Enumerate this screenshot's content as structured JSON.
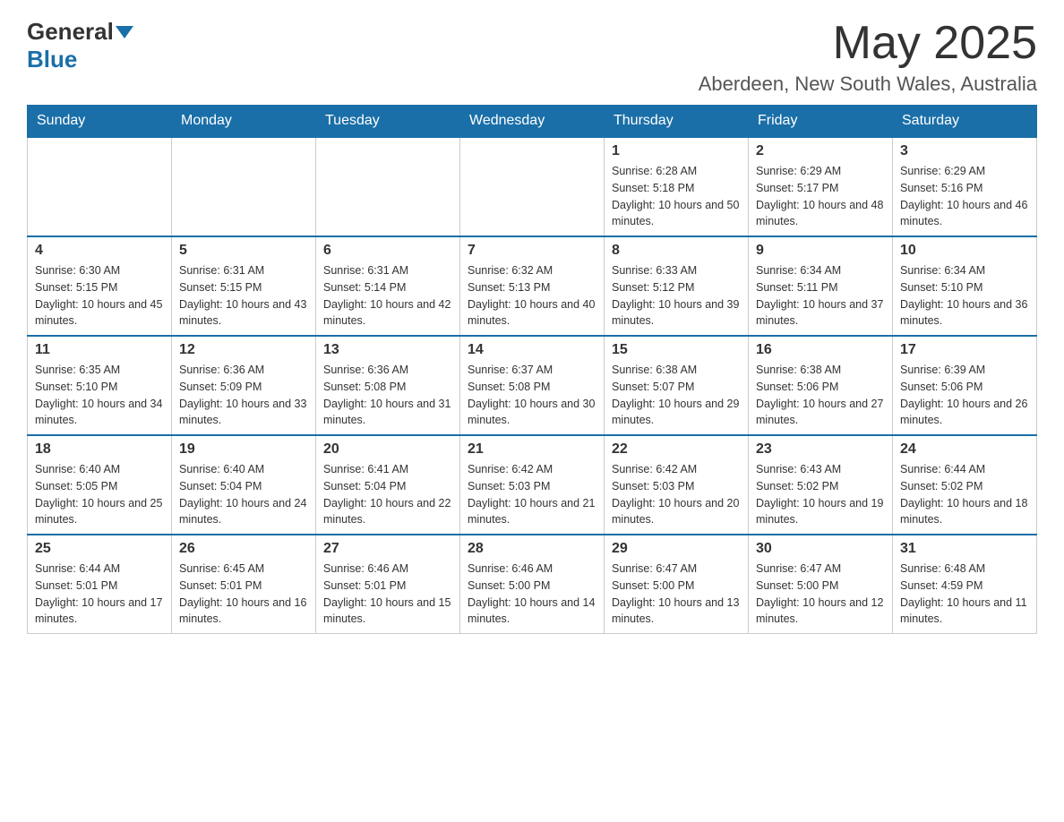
{
  "header": {
    "logo_general": "General",
    "logo_blue": "Blue",
    "month_title": "May 2025",
    "location": "Aberdeen, New South Wales, Australia"
  },
  "calendar": {
    "days_of_week": [
      "Sunday",
      "Monday",
      "Tuesday",
      "Wednesday",
      "Thursday",
      "Friday",
      "Saturday"
    ],
    "weeks": [
      [
        {
          "day": "",
          "info": ""
        },
        {
          "day": "",
          "info": ""
        },
        {
          "day": "",
          "info": ""
        },
        {
          "day": "",
          "info": ""
        },
        {
          "day": "1",
          "info": "Sunrise: 6:28 AM\nSunset: 5:18 PM\nDaylight: 10 hours and 50 minutes."
        },
        {
          "day": "2",
          "info": "Sunrise: 6:29 AM\nSunset: 5:17 PM\nDaylight: 10 hours and 48 minutes."
        },
        {
          "day": "3",
          "info": "Sunrise: 6:29 AM\nSunset: 5:16 PM\nDaylight: 10 hours and 46 minutes."
        }
      ],
      [
        {
          "day": "4",
          "info": "Sunrise: 6:30 AM\nSunset: 5:15 PM\nDaylight: 10 hours and 45 minutes."
        },
        {
          "day": "5",
          "info": "Sunrise: 6:31 AM\nSunset: 5:15 PM\nDaylight: 10 hours and 43 minutes."
        },
        {
          "day": "6",
          "info": "Sunrise: 6:31 AM\nSunset: 5:14 PM\nDaylight: 10 hours and 42 minutes."
        },
        {
          "day": "7",
          "info": "Sunrise: 6:32 AM\nSunset: 5:13 PM\nDaylight: 10 hours and 40 minutes."
        },
        {
          "day": "8",
          "info": "Sunrise: 6:33 AM\nSunset: 5:12 PM\nDaylight: 10 hours and 39 minutes."
        },
        {
          "day": "9",
          "info": "Sunrise: 6:34 AM\nSunset: 5:11 PM\nDaylight: 10 hours and 37 minutes."
        },
        {
          "day": "10",
          "info": "Sunrise: 6:34 AM\nSunset: 5:10 PM\nDaylight: 10 hours and 36 minutes."
        }
      ],
      [
        {
          "day": "11",
          "info": "Sunrise: 6:35 AM\nSunset: 5:10 PM\nDaylight: 10 hours and 34 minutes."
        },
        {
          "day": "12",
          "info": "Sunrise: 6:36 AM\nSunset: 5:09 PM\nDaylight: 10 hours and 33 minutes."
        },
        {
          "day": "13",
          "info": "Sunrise: 6:36 AM\nSunset: 5:08 PM\nDaylight: 10 hours and 31 minutes."
        },
        {
          "day": "14",
          "info": "Sunrise: 6:37 AM\nSunset: 5:08 PM\nDaylight: 10 hours and 30 minutes."
        },
        {
          "day": "15",
          "info": "Sunrise: 6:38 AM\nSunset: 5:07 PM\nDaylight: 10 hours and 29 minutes."
        },
        {
          "day": "16",
          "info": "Sunrise: 6:38 AM\nSunset: 5:06 PM\nDaylight: 10 hours and 27 minutes."
        },
        {
          "day": "17",
          "info": "Sunrise: 6:39 AM\nSunset: 5:06 PM\nDaylight: 10 hours and 26 minutes."
        }
      ],
      [
        {
          "day": "18",
          "info": "Sunrise: 6:40 AM\nSunset: 5:05 PM\nDaylight: 10 hours and 25 minutes."
        },
        {
          "day": "19",
          "info": "Sunrise: 6:40 AM\nSunset: 5:04 PM\nDaylight: 10 hours and 24 minutes."
        },
        {
          "day": "20",
          "info": "Sunrise: 6:41 AM\nSunset: 5:04 PM\nDaylight: 10 hours and 22 minutes."
        },
        {
          "day": "21",
          "info": "Sunrise: 6:42 AM\nSunset: 5:03 PM\nDaylight: 10 hours and 21 minutes."
        },
        {
          "day": "22",
          "info": "Sunrise: 6:42 AM\nSunset: 5:03 PM\nDaylight: 10 hours and 20 minutes."
        },
        {
          "day": "23",
          "info": "Sunrise: 6:43 AM\nSunset: 5:02 PM\nDaylight: 10 hours and 19 minutes."
        },
        {
          "day": "24",
          "info": "Sunrise: 6:44 AM\nSunset: 5:02 PM\nDaylight: 10 hours and 18 minutes."
        }
      ],
      [
        {
          "day": "25",
          "info": "Sunrise: 6:44 AM\nSunset: 5:01 PM\nDaylight: 10 hours and 17 minutes."
        },
        {
          "day": "26",
          "info": "Sunrise: 6:45 AM\nSunset: 5:01 PM\nDaylight: 10 hours and 16 minutes."
        },
        {
          "day": "27",
          "info": "Sunrise: 6:46 AM\nSunset: 5:01 PM\nDaylight: 10 hours and 15 minutes."
        },
        {
          "day": "28",
          "info": "Sunrise: 6:46 AM\nSunset: 5:00 PM\nDaylight: 10 hours and 14 minutes."
        },
        {
          "day": "29",
          "info": "Sunrise: 6:47 AM\nSunset: 5:00 PM\nDaylight: 10 hours and 13 minutes."
        },
        {
          "day": "30",
          "info": "Sunrise: 6:47 AM\nSunset: 5:00 PM\nDaylight: 10 hours and 12 minutes."
        },
        {
          "day": "31",
          "info": "Sunrise: 6:48 AM\nSunset: 4:59 PM\nDaylight: 10 hours and 11 minutes."
        }
      ]
    ]
  }
}
